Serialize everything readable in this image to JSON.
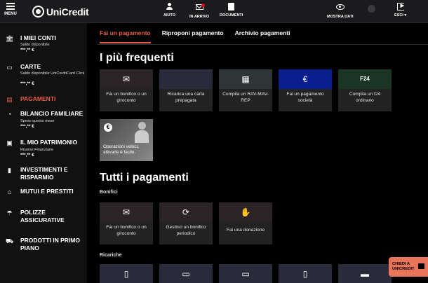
{
  "topbar": {
    "menu_label": "MENU",
    "brand": "UniCredit",
    "items": [
      {
        "label": "AIUTO",
        "icon": "user-help-icon"
      },
      {
        "label": "IN ARRIVO",
        "icon": "mail-icon"
      },
      {
        "label": "DOCUMENTI",
        "icon": "document-icon"
      },
      {
        "label": "MOSTRA DATI",
        "icon": "eye-icon"
      },
      {
        "label": "ESCI ▾",
        "icon": "exit-icon"
      }
    ]
  },
  "sidebar": {
    "items": [
      {
        "title": "I MIEI CONTI",
        "sub": "Saldo disponibile",
        "amount": "***,** €",
        "icon": "bank-icon"
      },
      {
        "title": "CARTE",
        "sub": "Saldo disponibile UniCreditCard Click",
        "amount": "***,** €",
        "icon": "card-icon"
      },
      {
        "title": "PAGAMENTI",
        "sub": "",
        "amount": "",
        "icon": "payments-icon"
      },
      {
        "title": "BILANCIO FAMILIARE",
        "sub": "Speso questo mese",
        "amount": "***,** €",
        "icon": "pie-icon"
      },
      {
        "title": "IL MIO PATRIMONIO",
        "sub": "Risorse Finanziarie",
        "amount": "***,** €",
        "icon": "wallet-icon"
      },
      {
        "title": "INVESTIMENTI E RISPARMIO",
        "sub": "",
        "amount": "",
        "icon": "bars-icon"
      },
      {
        "title": "MUTUI E PRESTITI",
        "sub": "",
        "amount": "",
        "icon": "house-icon"
      },
      {
        "title": "POLIZZE ASSICURATIVE",
        "sub": "",
        "amount": "",
        "icon": "umbrella-icon"
      },
      {
        "title": "PRODOTTI IN PRIMO PIANO",
        "sub": "",
        "amount": "",
        "icon": "cart-icon"
      }
    ]
  },
  "tabs": [
    {
      "label": "Fai un pagamento",
      "active": true
    },
    {
      "label": "Riproponi pagamento",
      "active": false
    },
    {
      "label": "Archivio pagamenti",
      "active": false
    }
  ],
  "frequent": {
    "title": "I più frequenti",
    "cards": [
      {
        "label": "Fai un bonifico o un giroconto",
        "icon": "bank-transfer-icon",
        "color": "#2b2426"
      },
      {
        "label": "Ricarica una carta prepagata",
        "icon": "prepaid-card-icon",
        "color": "#2a2b3a"
      },
      {
        "label": "Compila un RAV-MAV-REP",
        "icon": "form-icon",
        "color": "#2e3536"
      },
      {
        "label": "Fai un pagamento società",
        "icon": "euro-bill-icon",
        "color": "#0a1f8f"
      },
      {
        "label": "Compila un f24 ordinario",
        "icon": "f24-icon",
        "color": "#1a3524"
      }
    ],
    "promo_text": "Operazioni veloci, attivarle è facile."
  },
  "all": {
    "title": "Tutti i pagamenti",
    "bonifici_label": "Bonifici",
    "bonifici": [
      {
        "label": "Fai un bonifico o un giroconto",
        "icon": "bank-transfer-icon",
        "color": "#2b2426"
      },
      {
        "label": "Gestisci un bonifico periodico",
        "icon": "recurring-transfer-icon",
        "color": "#2b2426"
      },
      {
        "label": "Fai una donazione",
        "icon": "donation-icon",
        "color": "#2b2426"
      }
    ],
    "ricariche_label": "Ricariche",
    "ricariche": [
      {
        "icon": "phone-euro-icon",
        "color": "#2a2b3a"
      },
      {
        "icon": "card-topup-icon",
        "color": "#2a2b3a"
      },
      {
        "icon": "card-topup-icon",
        "color": "#2a2b3a"
      },
      {
        "icon": "mobile-topup-icon",
        "color": "#2a2b3a"
      },
      {
        "icon": "bus-icon",
        "color": "#2a2b3a"
      }
    ]
  },
  "chat": {
    "label": "CHIEDI A UNICREDIT",
    "color": "#e8745a"
  },
  "accent": "#e85d44"
}
